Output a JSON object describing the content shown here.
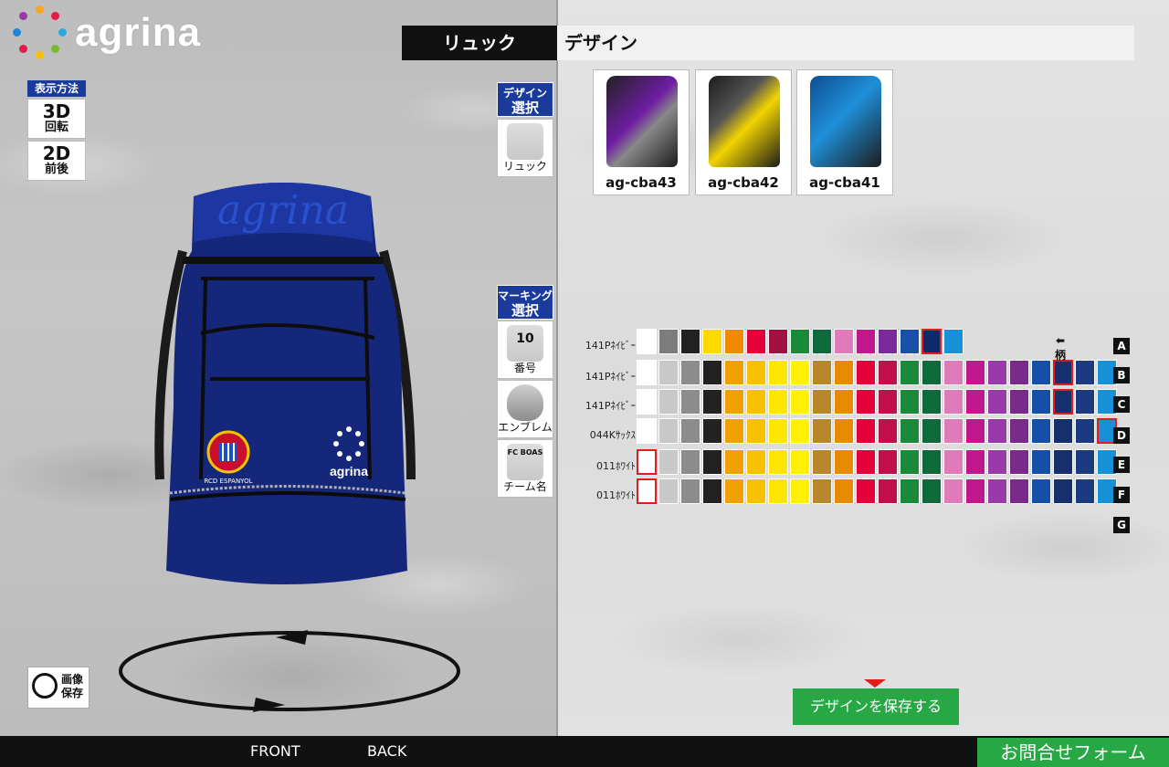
{
  "brand": {
    "name": "agrina"
  },
  "view_mode": {
    "label": "表示方法",
    "options": [
      {
        "main": "3D",
        "sub": "回転",
        "active": true
      },
      {
        "main": "2D",
        "sub": "前後",
        "active": false
      }
    ]
  },
  "header": {
    "product": "リュック",
    "section": "デザイン"
  },
  "design_menu": {
    "head_line1": "デザイン",
    "head_line2": "選択",
    "items": [
      {
        "label": "リュック"
      }
    ]
  },
  "marking_menu": {
    "head_line1": "マーキング",
    "head_line2": "選択",
    "items": [
      {
        "label": "番号",
        "thumb_text": "10"
      },
      {
        "label": "エンブレム",
        "thumb_text": ""
      },
      {
        "label": "チーム名",
        "thumb_text": "FC BOAS"
      }
    ]
  },
  "designs": [
    {
      "code": "ag-cba43",
      "colors": [
        "#1c1c1c",
        "#6e1ea3"
      ]
    },
    {
      "code": "ag-cba42",
      "colors": [
        "#1c1c1c",
        "#f2d400"
      ]
    },
    {
      "code": "ag-cba41",
      "colors": [
        "#1c1c1c",
        "#1f8fd8"
      ]
    }
  ],
  "bag": {
    "emblem_text": "RCD ESPANYOL",
    "logo_text": "agrina",
    "top_text": "agrina"
  },
  "palette": {
    "pattern_label": "柄",
    "letters": [
      "A",
      "B",
      "C",
      "D",
      "E",
      "F",
      "G"
    ],
    "rows": [
      {
        "label": "141Pﾈｲﾋﾞｰ",
        "colors": [
          "#ffffff",
          "#7d7d7d",
          "#222222",
          "#ffd800",
          "#f08a00",
          "#e6003a",
          "#a01040",
          "#1a8a3a",
          "#0e6a3a",
          "#e07ab8",
          "#c0188a",
          "#7a2a9a",
          "#1a50a8",
          "#0f2a6a",
          "#1890d8"
        ],
        "selected": 13
      },
      {
        "label": "141Pﾈｲﾋﾞｰ",
        "colors": [
          "#ffffff",
          "#c8c8c8",
          "#8c8c8c",
          "#222222",
          "#f0a000",
          "#f7c000",
          "#ffe600",
          "#fff100",
          "#b8862b",
          "#e88a00",
          "#e6003a",
          "#c0104a",
          "#1a8a3a",
          "#0e6a3a",
          "#e07ab8",
          "#c0188a",
          "#9a3aaa",
          "#7a2a8a",
          "#1450a8",
          "#16306e",
          "#1c3a80",
          "#1890d8"
        ],
        "selected": 19
      },
      {
        "label": "141Pﾈｲﾋﾞｰ",
        "colors": [
          "#ffffff",
          "#c8c8c8",
          "#8c8c8c",
          "#222222",
          "#f0a000",
          "#f7c000",
          "#ffe600",
          "#fff100",
          "#b8862b",
          "#e88a00",
          "#e6003a",
          "#c0104a",
          "#1a8a3a",
          "#0e6a3a",
          "#e07ab8",
          "#c0188a",
          "#9a3aaa",
          "#7a2a8a",
          "#1450a8",
          "#16306e",
          "#1c3a80",
          "#1890d8"
        ],
        "selected": 19
      },
      {
        "label": "044Kｻｯｸｽ",
        "colors": [
          "#ffffff",
          "#c8c8c8",
          "#8c8c8c",
          "#222222",
          "#f0a000",
          "#f7c000",
          "#ffe600",
          "#fff100",
          "#b8862b",
          "#e88a00",
          "#e6003a",
          "#c0104a",
          "#1a8a3a",
          "#0e6a3a",
          "#e07ab8",
          "#c0188a",
          "#9a3aaa",
          "#7a2a8a",
          "#1450a8",
          "#16306e",
          "#1c3a80",
          "#1890d8"
        ],
        "selected": 21
      },
      {
        "label": "011ﾎﾜｲﾄ",
        "colors": [
          "#ffffff",
          "#c8c8c8",
          "#8c8c8c",
          "#222222",
          "#f0a000",
          "#f7c000",
          "#ffe600",
          "#fff100",
          "#b8862b",
          "#e88a00",
          "#e6003a",
          "#c0104a",
          "#1a8a3a",
          "#0e6a3a",
          "#e07ab8",
          "#c0188a",
          "#9a3aaa",
          "#7a2a8a",
          "#1450a8",
          "#16306e",
          "#1c3a80",
          "#1890d8"
        ],
        "selected": 0
      },
      {
        "label": "011ﾎﾜｲﾄ",
        "colors": [
          "#ffffff",
          "#c8c8c8",
          "#8c8c8c",
          "#222222",
          "#f0a000",
          "#f7c000",
          "#ffe600",
          "#fff100",
          "#b8862b",
          "#e88a00",
          "#e6003a",
          "#c0104a",
          "#1a8a3a",
          "#0e6a3a",
          "#e07ab8",
          "#c0188a",
          "#9a3aaa",
          "#7a2a8a",
          "#1450a8",
          "#16306e",
          "#1c3a80",
          "#1890d8"
        ],
        "selected": 0
      }
    ]
  },
  "actions": {
    "save_image_l1": "画像",
    "save_image_l2": "保存",
    "save_design": "デザインを保存する",
    "front": "FRONT",
    "back": "BACK",
    "contact": "お問合せフォーム"
  }
}
